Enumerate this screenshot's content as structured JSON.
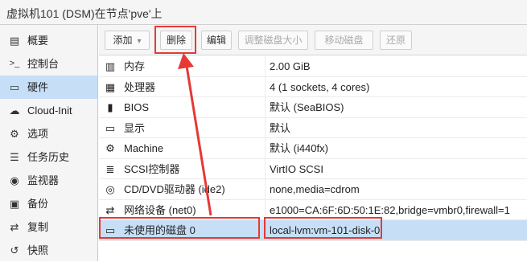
{
  "window": {
    "title": "虚拟机101 (DSM)在节点'pve'上"
  },
  "sidebar": {
    "items": [
      {
        "label": "概要",
        "icon": "book-icon",
        "glyph": "▤"
      },
      {
        "label": "控制台",
        "icon": "terminal-icon",
        "glyph": ">_"
      },
      {
        "label": "硬件",
        "icon": "monitor-icon",
        "glyph": "▭",
        "active": true
      },
      {
        "label": "Cloud-Init",
        "icon": "cloud-icon",
        "glyph": "☁"
      },
      {
        "label": "选项",
        "icon": "gear-icon",
        "glyph": "⚙"
      },
      {
        "label": "任务历史",
        "icon": "list-icon",
        "glyph": "☰"
      },
      {
        "label": "监视器",
        "icon": "eye-icon",
        "glyph": "◉"
      },
      {
        "label": "备份",
        "icon": "floppy-icon",
        "glyph": "▣"
      },
      {
        "label": "复制",
        "icon": "retweet-icon",
        "glyph": "⇄"
      },
      {
        "label": "快照",
        "icon": "history-icon",
        "glyph": "↺"
      }
    ]
  },
  "toolbar": {
    "add_label": "添加",
    "delete_label": "删除",
    "edit_label": "编辑",
    "resize_label": "调整磁盘大小",
    "move_label": "移动磁盘",
    "revert_label": "还原"
  },
  "hardware": {
    "rows": [
      {
        "name": "内存",
        "value": "2.00 GiB",
        "icon": "memory-icon",
        "glyph": "▥"
      },
      {
        "name": "处理器",
        "value": "4 (1 sockets, 4 cores)",
        "icon": "cpu-icon",
        "glyph": "▦"
      },
      {
        "name": "BIOS",
        "value": "默认 (SeaBIOS)",
        "icon": "chip-icon",
        "glyph": "▮"
      },
      {
        "name": "显示",
        "value": "默认",
        "icon": "desktop-icon",
        "glyph": "▭"
      },
      {
        "name": "Machine",
        "value": "默认 (i440fx)",
        "icon": "cogs-icon",
        "glyph": "⚙"
      },
      {
        "name": "SCSI控制器",
        "value": "VirtIO SCSI",
        "icon": "database-icon",
        "glyph": "≣"
      },
      {
        "name": "CD/DVD驱动器 (ide2)",
        "value": "none,media=cdrom",
        "icon": "cdrom-icon",
        "glyph": "◎"
      },
      {
        "name": "网络设备 (net0)",
        "value": "e1000=CA:6F:6D:50:1E:82,bridge=vmbr0,firewall=1",
        "icon": "exchange-icon",
        "glyph": "⇄"
      },
      {
        "name": "未使用的磁盘 0",
        "value": "local-lvm:vm-101-disk-0",
        "icon": "hdd-icon",
        "glyph": "▭",
        "selected": true
      }
    ]
  },
  "colors": {
    "highlight": "#e53935",
    "selection": "#c6dff7"
  }
}
